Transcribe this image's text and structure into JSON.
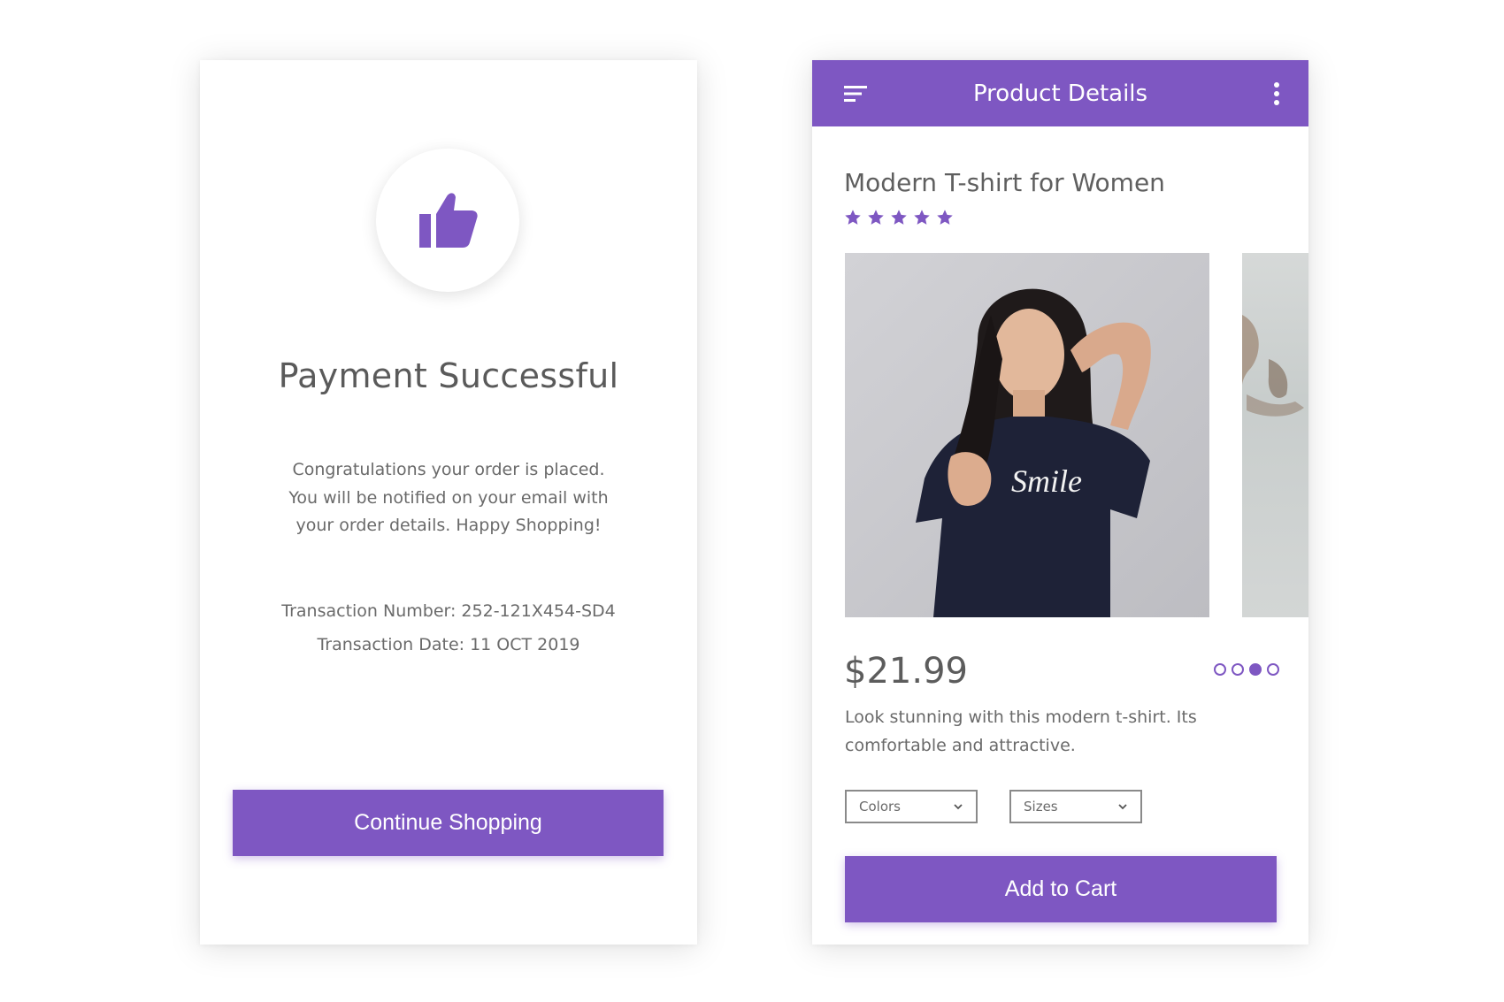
{
  "payment_screen": {
    "icon": "thumbs-up-icon",
    "title": "Payment Successful",
    "message": "Congratulations your order is placed. You will be notified on your email with your order details. Happy Shopping!",
    "transaction_number_line": "Transaction Number: 252-121X454-SD4",
    "transaction_date_line": "Transaction Date: 11 OCT 2019",
    "continue_button_label": "Continue Shopping"
  },
  "product_screen": {
    "appbar": {
      "title": "Product Details",
      "left_icon": "menu-sort-icon",
      "right_icon": "more-vertical-icon"
    },
    "product_title": "Modern T-shirt for Women",
    "rating": {
      "value": 5,
      "max": 5
    },
    "image_text": "Smile",
    "carousel": {
      "total": 4,
      "active_index": 2
    },
    "price": "$21.99",
    "description": "Look stunning with this modern t-shirt. Its comfortable and attractive.",
    "colors_select": "Colors",
    "sizes_select": "Sizes",
    "add_to_cart_label": "Add to Cart"
  },
  "colors": {
    "accent": "#7e57c2",
    "text": "#5f5f5f",
    "background": "#ffffff"
  }
}
